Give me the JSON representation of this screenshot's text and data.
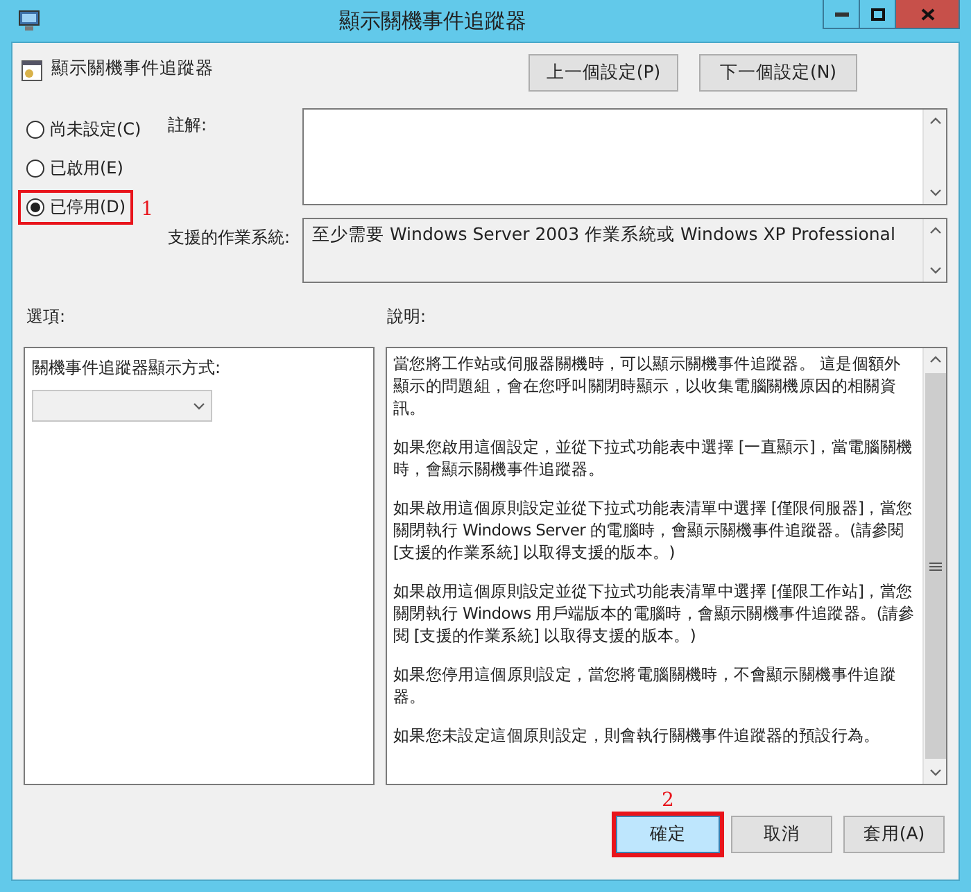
{
  "window": {
    "title": "顯示關機事件追蹤器"
  },
  "header": {
    "title": "顯示關機事件追蹤器"
  },
  "nav_buttons": [
    {
      "label": "上一個設定(P)"
    },
    {
      "label": "下一個設定(N)"
    }
  ],
  "radios": [
    {
      "label": "尚未設定(C)",
      "selected": false
    },
    {
      "label": "已啟用(E)",
      "selected": false
    },
    {
      "label": "已停用(D)",
      "selected": true,
      "callout": "1"
    }
  ],
  "comment": {
    "label": "註解:"
  },
  "supported": {
    "label": "支援的作業系統:",
    "value": "至少需要 Windows Server 2003 作業系統或 Windows XP Professional"
  },
  "options": {
    "label": "選項:",
    "dropdown_label": "關機事件追蹤器顯示方式:",
    "dropdown_disabled": true
  },
  "help": {
    "label": "說明:",
    "paragraphs": [
      "當您將工作站或伺服器關機時，可以顯示關機事件追蹤器。 這是個額外顯示的問題組，會在您呼叫關閉時顯示，以收集電腦關機原因的相關資訊。",
      "如果您啟用這個設定，並從下拉式功能表中選擇 [一直顯示]，當電腦關機時，會顯示關機事件追蹤器。",
      "如果啟用這個原則設定並從下拉式功能表清單中選擇 [僅限伺服器]，當您關閉執行 Windows Server 的電腦時，會顯示關機事件追蹤器。(請參閱 [支援的作業系統] 以取得支援的版本。)",
      "如果啟用這個原則設定並從下拉式功能表清單中選擇 [僅限工作站]，當您關閉執行 Windows 用戶端版本的電腦時，會顯示關機事件追蹤器。(請參閱 [支援的作業系統] 以取得支援的版本。)",
      "如果您停用這個原則設定，當您將電腦關機時，不會顯示關機事件追蹤器。",
      "如果您未設定這個原則設定，則會執行關機事件追蹤器的預設行為。"
    ]
  },
  "buttons": [
    {
      "label": "確定",
      "hovered": true,
      "callout": "2"
    },
    {
      "label": "取消",
      "hovered": false
    },
    {
      "label": "套用(A)",
      "hovered": false
    }
  ]
}
